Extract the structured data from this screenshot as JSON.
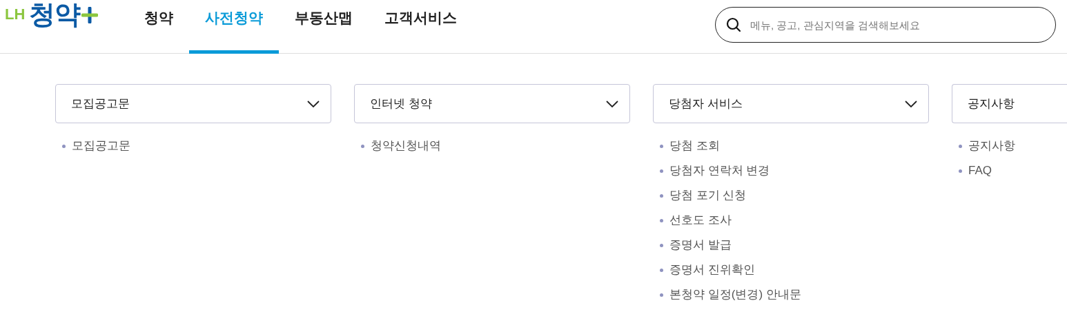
{
  "logo": {
    "prefix": "LH",
    "name": "청약"
  },
  "nav": [
    {
      "label": "청약",
      "selected": false
    },
    {
      "label": "사전청약",
      "selected": true
    },
    {
      "label": "부동산맵",
      "selected": false
    },
    {
      "label": "고객서비스",
      "selected": false
    }
  ],
  "search": {
    "placeholder": "메뉴, 공고, 관심지역을 검색해보세요"
  },
  "columns": [
    {
      "title": "모집공고문",
      "chevron": true,
      "links": [
        "모집공고문"
      ]
    },
    {
      "title": "인터넷 청약",
      "chevron": true,
      "links": [
        "청약신청내역"
      ]
    },
    {
      "title": "당첨자 서비스",
      "chevron": true,
      "links": [
        "당첨 조회",
        "당첨자 연락처 변경",
        "당첨 포기 신청",
        "선호도 조사",
        "증명서 발급",
        "증명서 진위확인",
        "본청약 일정(변경) 안내문"
      ]
    },
    {
      "title": "공지사항",
      "chevron": false,
      "links": [
        "공지사항",
        "FAQ"
      ]
    }
  ]
}
